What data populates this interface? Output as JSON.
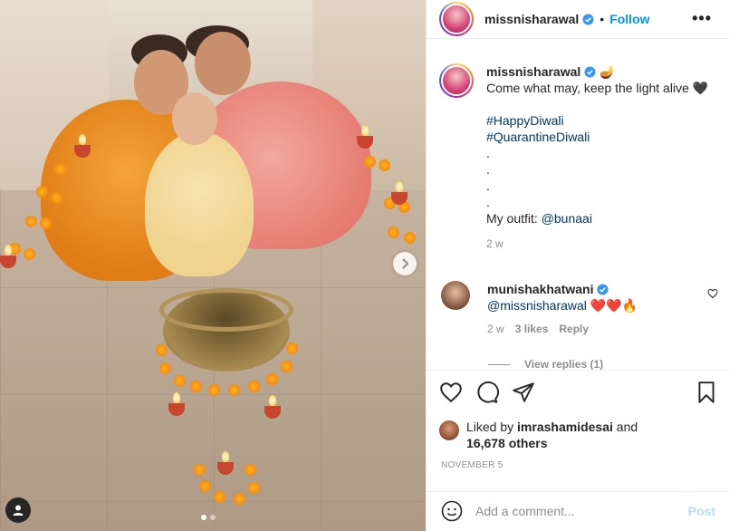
{
  "post": {
    "username": "missnisharawal",
    "follow_label": "Follow",
    "separator": "•",
    "more_label": "•••"
  },
  "caption": {
    "username": "missnisharawal",
    "emoji": "🪔",
    "line1": "Come what may, keep the light alive 🖤",
    "hashtag1": "#HappyDiwali",
    "hashtag2": "#QuarantineDiwali",
    "dots": [
      ".",
      ".",
      ".",
      "."
    ],
    "outfit_prefix": "My outfit: ",
    "outfit_mention": "@bunaai",
    "age": "2 w"
  },
  "comment": {
    "username": "munishakhatwani",
    "mention": "@missnisharawal",
    "emojis": "❤️❤️🔥",
    "age": "2 w",
    "likes": "3 likes",
    "reply": "Reply",
    "view_replies": "View replies (1)"
  },
  "likes": {
    "prefix": "Liked by ",
    "user": "imrashamidesai",
    "middle": " and",
    "others": "16,678 others"
  },
  "date": "NOVEMBER 5",
  "add_comment": {
    "placeholder": "Add a comment...",
    "post_label": "Post"
  },
  "carousel": {
    "slides": 2,
    "active": 1
  },
  "colors": {
    "link": "#0095f6",
    "hashtag": "#00376b",
    "muted": "#8e8e8e",
    "verified": "#3897f0"
  }
}
